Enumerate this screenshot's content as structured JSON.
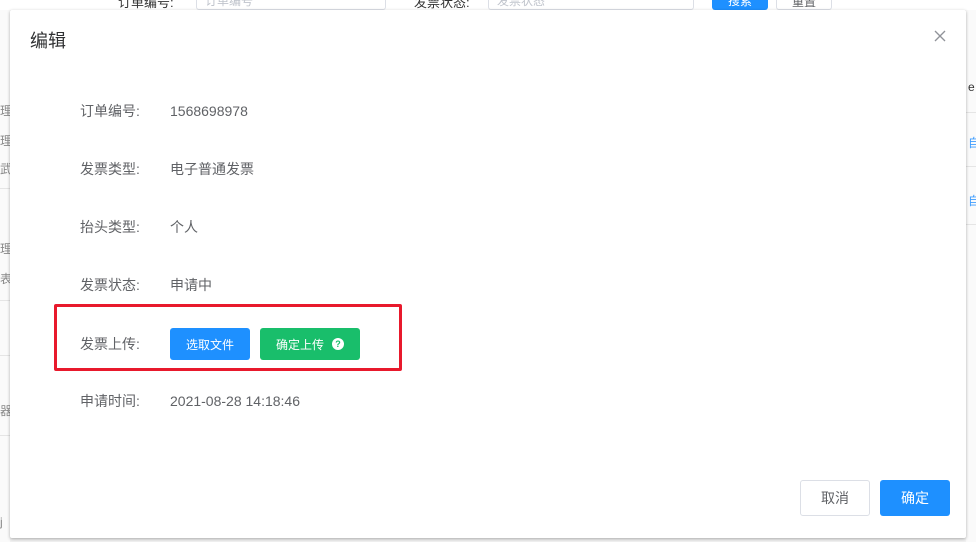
{
  "background": {
    "search": {
      "order_label": "订单编号:",
      "order_placeholder": "订单编号",
      "status_label": "发票状态:",
      "status_placeholder": "发票状态",
      "search_button": "搜索",
      "reset_button": "重置"
    },
    "left_fragments": [
      "理",
      "理",
      "武",
      "理",
      "表",
      "器",
      "j"
    ],
    "right_fragments": [
      "e",
      "自",
      "自"
    ]
  },
  "dialog": {
    "title": "编辑",
    "close_icon": "close-icon",
    "fields": [
      {
        "label": "订单编号:",
        "value": "1568698978"
      },
      {
        "label": "发票类型:",
        "value": "电子普通发票"
      },
      {
        "label": "抬头类型:",
        "value": "个人"
      },
      {
        "label": "发票状态:",
        "value": "申请中"
      }
    ],
    "upload": {
      "label": "发票上传:",
      "select_button": "选取文件",
      "confirm_button": "确定上传",
      "help_icon": "question-circle-icon"
    },
    "apply_time": {
      "label": "申请时间:",
      "value": "2021-08-28 14:18:46"
    },
    "footer": {
      "cancel": "取消",
      "ok": "确定"
    }
  },
  "colors": {
    "primary": "#1e90ff",
    "success": "#19be6b",
    "highlight": "#e8192c"
  }
}
